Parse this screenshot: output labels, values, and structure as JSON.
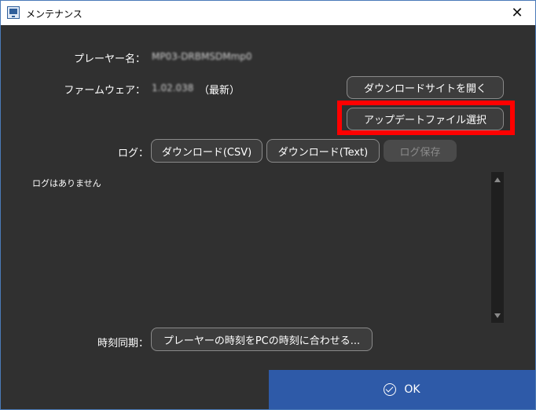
{
  "window": {
    "title": "メンテナンス",
    "close_glyph": "✕"
  },
  "info": {
    "player_name_label": "プレーヤー名：",
    "player_name_value": "MP03-DRBMSDMmp0",
    "firmware_label": "ファームウェア：",
    "firmware_version": "1.02.038",
    "firmware_status": "（最新）"
  },
  "buttons": {
    "open_download_site": "ダウンロードサイトを開く",
    "select_update_file": "アップデートファイル選択",
    "log_label": "ログ：",
    "download_csv": "ダウンロード(CSV)",
    "download_text": "ダウンロード(Text)",
    "save_log": "ログ保存"
  },
  "log": {
    "empty_message": "ログはありません"
  },
  "time_sync": {
    "label": "時刻同期：",
    "button": "プレーヤーの時刻をPCの時刻に合わせる..."
  },
  "footer": {
    "ok_label": "OK"
  },
  "colors": {
    "highlight": "#ff0000",
    "ok_background": "#2e5aa8",
    "panel_bg": "#303030"
  },
  "icons": {
    "app": "app-window-icon",
    "ok": "check-circle-icon",
    "close": "close-icon"
  }
}
